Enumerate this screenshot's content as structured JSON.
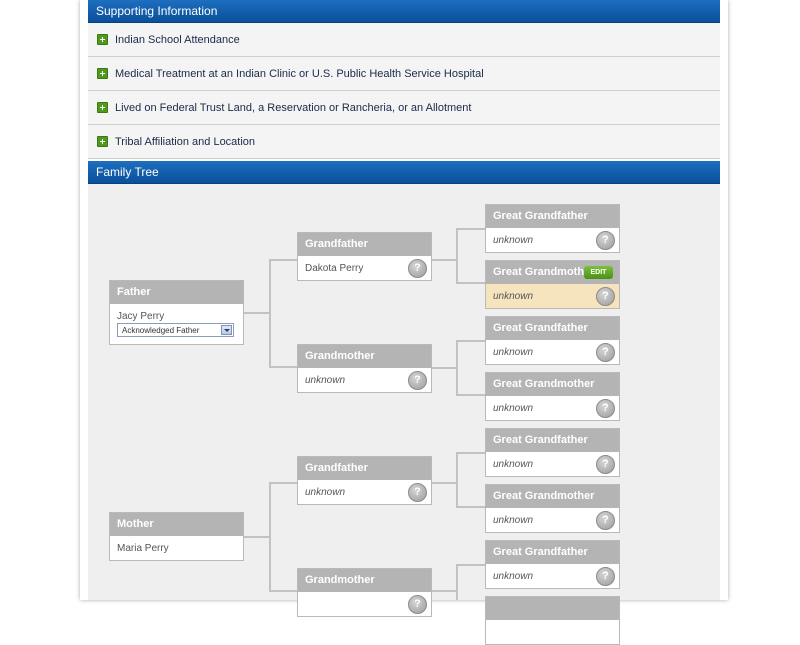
{
  "supporting": {
    "title": "Supporting Information",
    "items": [
      {
        "label": "Indian School Attendance"
      },
      {
        "label": "Medical Treatment at an Indian Clinic or U.S. Public Health Service Hospital"
      },
      {
        "label": "Lived on Federal Trust Land, a Reservation or Rancheria, or an Allotment"
      },
      {
        "label": "Tribal Affiliation and Location"
      }
    ]
  },
  "family_tree": {
    "title": "Family Tree",
    "father": {
      "role": "Father",
      "name": "Jacy Perry",
      "relationship": "Acknowledged Father"
    },
    "mother": {
      "role": "Mother",
      "name": "Maria Perry"
    },
    "paternal_grandfather": {
      "role": "Grandfather",
      "name": "Dakota Perry"
    },
    "paternal_grandmother": {
      "role": "Grandmother",
      "name": "unknown"
    },
    "maternal_grandfather": {
      "role": "Grandfather",
      "name": "unknown"
    },
    "maternal_grandmother": {
      "role": "Grandmother",
      "name": ""
    },
    "great_grandparents": [
      {
        "role": "Great Grandfather",
        "name": "unknown"
      },
      {
        "role": "Great Grandmother",
        "name": "unknown",
        "edit_label": "EDIT"
      },
      {
        "role": "Great Grandfather",
        "name": "unknown"
      },
      {
        "role": "Great Grandmother",
        "name": "unknown"
      },
      {
        "role": "Great Grandfather",
        "name": "unknown"
      },
      {
        "role": "Great Grandmother",
        "name": "unknown"
      },
      {
        "role": "Great Grandfather",
        "name": "unknown"
      }
    ],
    "help_icon_glyph": "?",
    "highlight_color": "#f5e4bd"
  }
}
